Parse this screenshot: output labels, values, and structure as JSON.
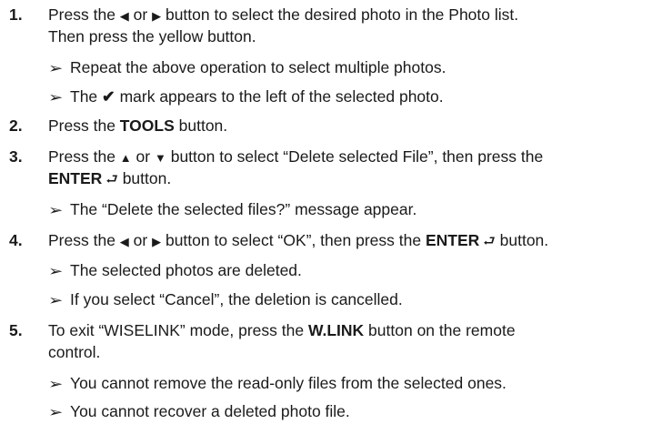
{
  "icons": {
    "arrow": "➢",
    "left": "◀",
    "right": "▶",
    "up": "▲",
    "down": "▼",
    "check": "✔",
    "enter": "⮐"
  },
  "steps": [
    {
      "num": "1.",
      "line1_a": "Press the ",
      "line1_b": " or ",
      "line1_c": " button to select the desired photo in the Photo list.",
      "line2": "Then press the yellow button.",
      "notes": [
        "Repeat the above operation to select multiple photos.",
        "The ",
        " mark appears to the left of the selected photo."
      ]
    },
    {
      "num": "2.",
      "a": "Press the ",
      "bold": "TOOLS",
      "b": " button."
    },
    {
      "num": "3.",
      "a": "Press the ",
      "b": " or ",
      "c": " button to select “Delete selected File”, then press the",
      "bold": "ENTER",
      "d": " button.",
      "note": "The “Delete the selected files?” message appear."
    },
    {
      "num": "4.",
      "a": "Press the ",
      "b": " or ",
      "c": " button to select “OK”, then press the ",
      "bold": "ENTER",
      "d": " button.",
      "notes": [
        "The selected photos are deleted.",
        "If you select “Cancel”, the deletion is cancelled."
      ]
    },
    {
      "num": "5.",
      "a": "To exit “WISELINK” mode, press the ",
      "bold": "W.LINK",
      "b": " button on the remote",
      "line2": "control.",
      "notes": [
        "You cannot remove the read-only files from the selected ones.",
        "You cannot recover a deleted photo file."
      ]
    }
  ]
}
